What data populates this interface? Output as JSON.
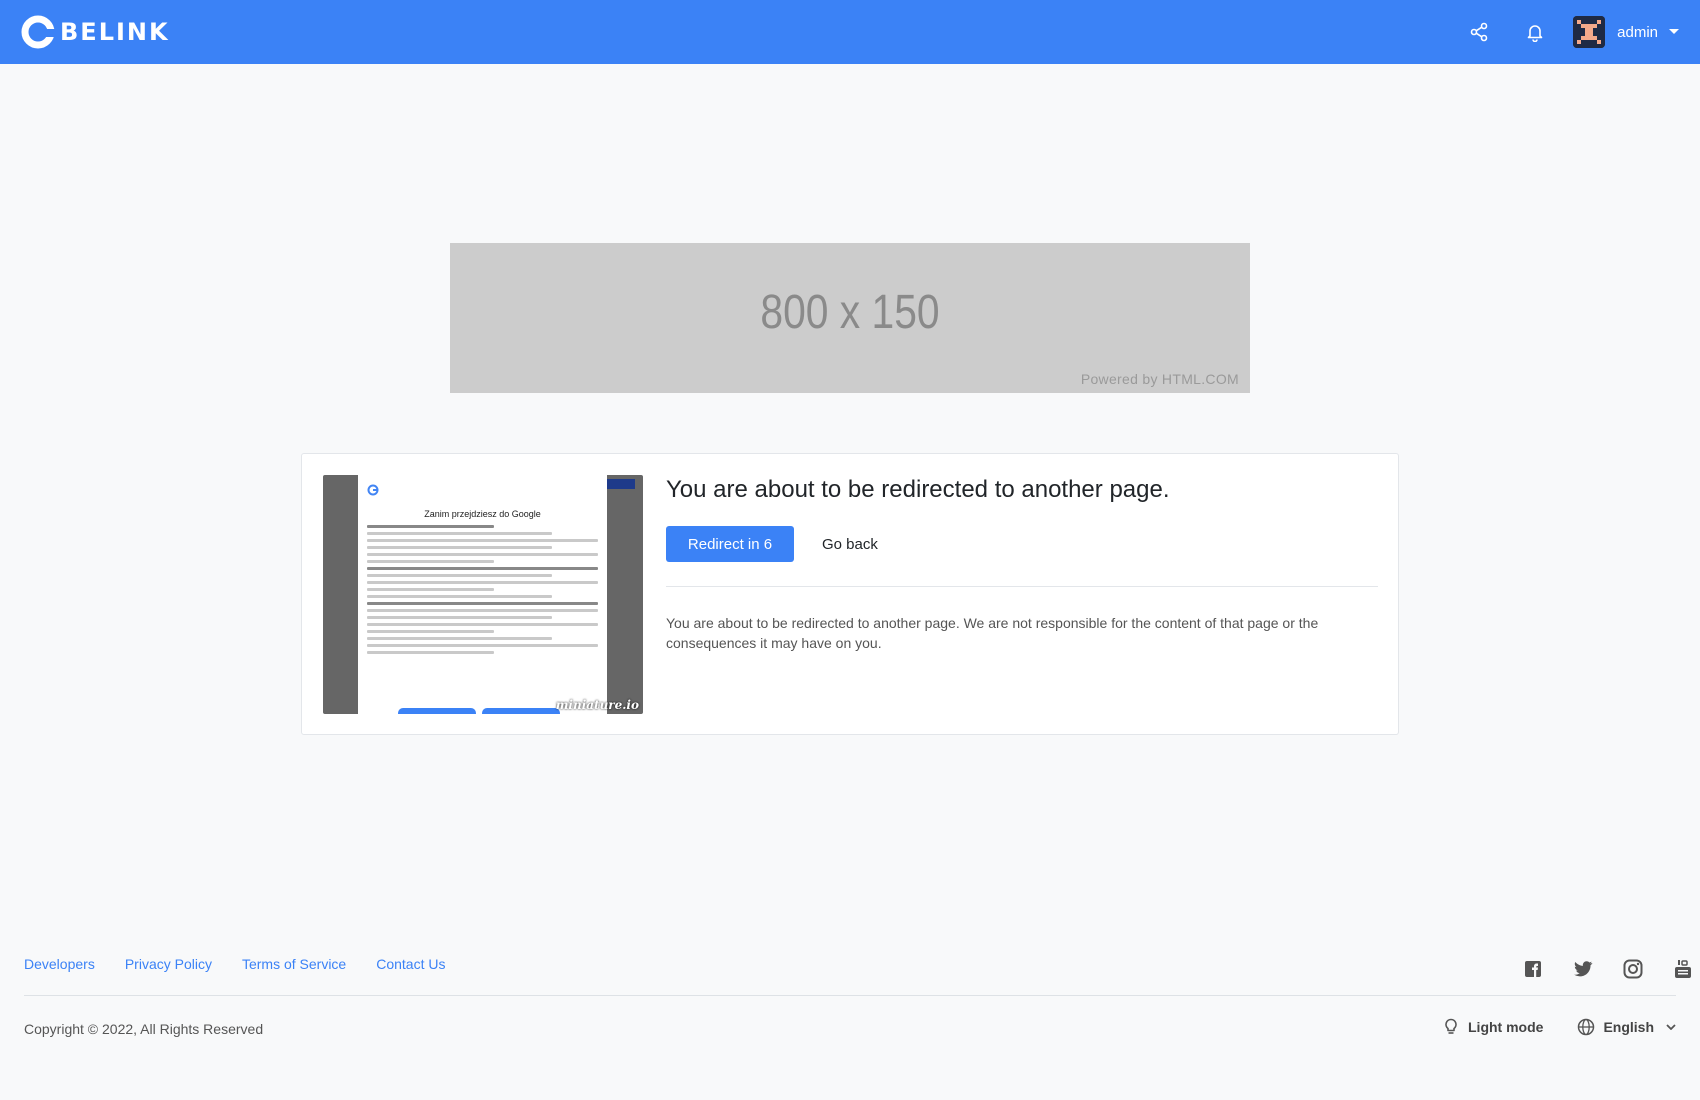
{
  "header": {
    "brand": "BELINK",
    "user_name": "admin",
    "bg_color": "#3b82f6"
  },
  "ad": {
    "size_text": "800 x 150",
    "powered_text": "Powered by HTML.COM"
  },
  "redirect": {
    "title": "You are about to be redirected to another page.",
    "redirect_button": "Redirect in 6",
    "back_button": "Go back",
    "message": "You are about to be redirected to another page. We are not responsible for the content of that page or the consequences it may have on you.",
    "thumbnail": {
      "title": "Zanim przejdziesz do Google",
      "watermark": "miniature.io"
    }
  },
  "footer": {
    "links": [
      "Developers",
      "Privacy Policy",
      "Terms of Service",
      "Contact Us"
    ],
    "social_icons": [
      "facebook-icon",
      "twitter-icon",
      "instagram-icon",
      "youtube-icon"
    ],
    "copyright": "Copyright © 2022, All Rights Reserved",
    "mode_label": "Light mode",
    "language": "English"
  }
}
